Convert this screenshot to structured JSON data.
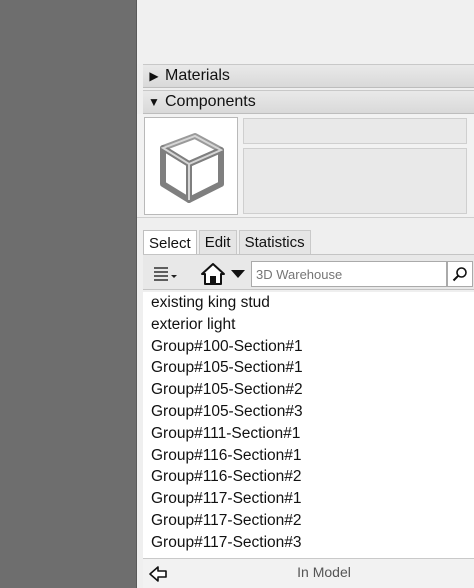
{
  "panels": {
    "materials": {
      "label": "Materials",
      "expanded": false
    },
    "components": {
      "label": "Components",
      "expanded": true
    }
  },
  "tabs": [
    {
      "label": "Select",
      "active": true
    },
    {
      "label": "Edit",
      "active": false
    },
    {
      "label": "Statistics",
      "active": false
    }
  ],
  "toolbar": {
    "view_options_icon": "list-view-icon",
    "home_icon": "house-icon",
    "navigation_dropdown_icon": "triangle-down-icon",
    "search_placeholder": "3D Warehouse",
    "search_icon": "magnifier-icon"
  },
  "components_list": [
    "existing king stud",
    "exterior light",
    "Group#100-Section#1",
    "Group#105-Section#1",
    "Group#105-Section#2",
    "Group#105-Section#3",
    "Group#111-Section#1",
    "Group#116-Section#1",
    "Group#116-Section#2",
    "Group#117-Section#1",
    "Group#117-Section#2",
    "Group#117-Section#3"
  ],
  "status": {
    "back_icon": "back-arrow-icon",
    "collection": "In Model"
  },
  "colors": {
    "left_strip": "#6e6e6e",
    "tray_bg": "#efefef",
    "list_bg": "#ffffff"
  }
}
